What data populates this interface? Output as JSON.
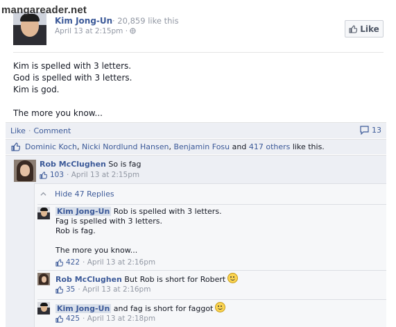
{
  "watermark": "mangareader.net",
  "post": {
    "page_name": "Kim Jong-Un",
    "like_count": "· 20,859 like this",
    "time": "April 13 at 2:15pm ·",
    "like_button": "Like",
    "text": [
      "Kim is spelled with 3 letters.",
      "God is spelled with 3 letters.",
      "Kim is god.",
      "",
      "The more you know..."
    ]
  },
  "actions": {
    "like": "Like",
    "comment": "Comment",
    "comment_count": "13"
  },
  "likers": {
    "names": [
      "Dominic Koch",
      "Nicki Nordlund Hansen",
      "Benjamin Fosu"
    ],
    "others": "417 others",
    "suffix": "like this."
  },
  "comments": [
    {
      "author": "Rob McClughen",
      "text": "So is fag",
      "likes": "103",
      "time": "· April 13 at 2:15pm"
    }
  ],
  "replies": {
    "toggle_label": "Hide 47 Replies",
    "items": [
      {
        "author": "Kim Jong-Un",
        "text_lines": [
          "Rob is spelled with 3 letters.",
          "Fag is spelled with 3 letters.",
          "Rob is fag.",
          "",
          "The more you know..."
        ],
        "likes": "422",
        "time": "· April 13 at 2:16pm"
      },
      {
        "author": "Rob McClughen",
        "text": "But Rob is short for Robert",
        "likes": "35",
        "time": "· April 13 at 2:16pm"
      },
      {
        "author": "Kim Jong-Un",
        "text": "and fag is short for faggot",
        "likes": "425",
        "time": "· April 13 at 2:18pm"
      }
    ]
  },
  "colors": {
    "link": "#3b5998",
    "meta": "#9197a3",
    "panel": "#edeff4"
  }
}
